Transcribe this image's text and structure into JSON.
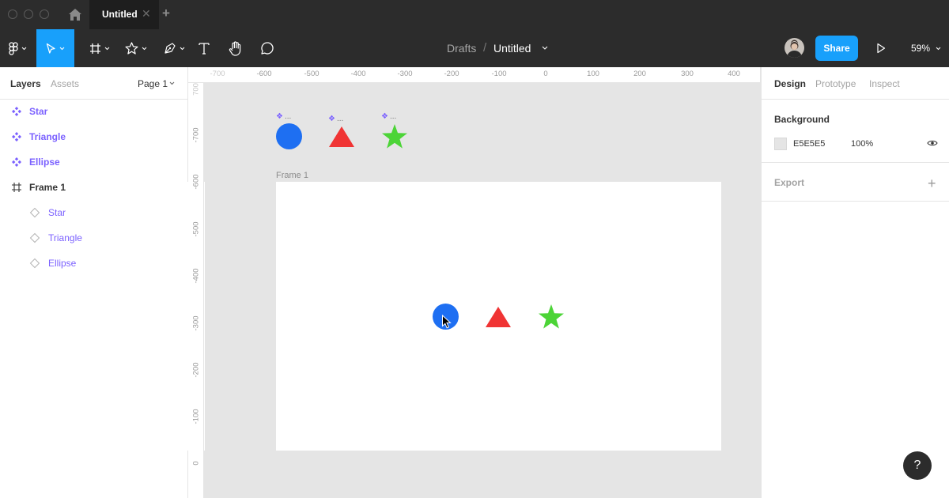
{
  "window": {
    "tab_title": "Untitled",
    "tab_close": "✕",
    "tab_add": "+"
  },
  "toolbar": {
    "breadcrumb_parent": "Drafts",
    "breadcrumb_separator": "/",
    "file_name": "Untitled",
    "share_label": "Share",
    "zoom_level": "59%",
    "active_tool": "move-tool",
    "icons": [
      "figma-menu-icon",
      "move-cursor-icon",
      "frame-hash-icon",
      "shape-star-icon",
      "pen-icon",
      "text-icon",
      "hand-icon",
      "comment-icon",
      "avatar",
      "play-icon"
    ],
    "accent_color": "#18a0fb"
  },
  "left_panel": {
    "tabs": [
      "Layers",
      "Assets"
    ],
    "active_tab": "Layers",
    "page_selector": "Page 1",
    "layers": [
      {
        "label": "Star",
        "kind": "component"
      },
      {
        "label": "Triangle",
        "kind": "component"
      },
      {
        "label": "Ellipse",
        "kind": "component"
      },
      {
        "label": "Frame 1",
        "kind": "frame"
      },
      {
        "label": "Star",
        "kind": "instance"
      },
      {
        "label": "Triangle",
        "kind": "instance"
      },
      {
        "label": "Ellipse",
        "kind": "instance"
      }
    ]
  },
  "rulers": {
    "top": [
      "-700",
      "-600",
      "-500",
      "-400",
      "-300",
      "-200",
      "-100",
      "0",
      "100",
      "200",
      "300",
      "400"
    ],
    "left": [
      "700",
      "-700",
      "-600",
      "-500",
      "-400",
      "-300",
      "-200",
      "-100",
      "0"
    ]
  },
  "canvas": {
    "background": "#e5e5e5",
    "frame_label": "Frame 1",
    "component_tag_dots": "...",
    "colors": {
      "ellipse": "#1e6ff2",
      "triangle": "#f03434",
      "star": "#4cd437",
      "component_purple": "#7b61ff"
    }
  },
  "right_panel": {
    "tabs": [
      "Design",
      "Prototype",
      "Inspect"
    ],
    "active_tab": "Design",
    "background": {
      "title": "Background",
      "hex": "E5E5E5",
      "opacity": "100%"
    },
    "export_title": "Export",
    "export_add": "+"
  },
  "help_label": "?"
}
